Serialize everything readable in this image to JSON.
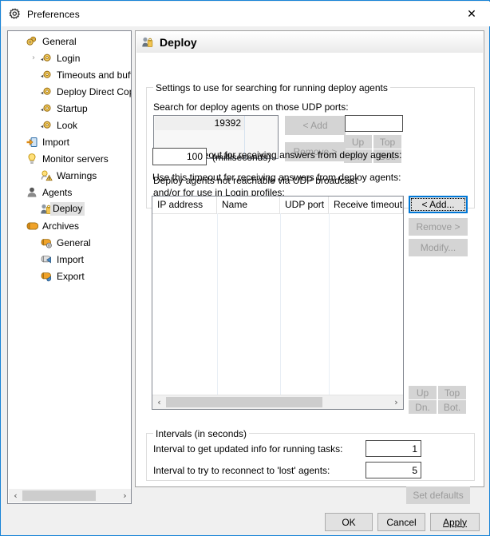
{
  "window": {
    "title": "Preferences",
    "title_icon": "gear-icon",
    "close_label": "✕"
  },
  "sidebar": {
    "items": [
      {
        "label": "General",
        "indent": 0,
        "icon": "gears-icon",
        "expander": "",
        "selected": false
      },
      {
        "label": "Login",
        "indent": 1,
        "icon": "gear-small-icon",
        "expander": "›",
        "selected": false
      },
      {
        "label": "Timeouts and buffer",
        "indent": 1,
        "icon": "gear-small-icon",
        "expander": "",
        "selected": false
      },
      {
        "label": "Deploy Direct Copy",
        "indent": 1,
        "icon": "gear-small-icon",
        "expander": "",
        "selected": false
      },
      {
        "label": "Startup",
        "indent": 1,
        "icon": "gear-small-icon",
        "expander": "",
        "selected": false
      },
      {
        "label": "Look",
        "indent": 1,
        "icon": "gear-small-icon",
        "expander": "",
        "selected": false
      },
      {
        "label": "Import",
        "indent": 0,
        "icon": "import-icon",
        "expander": "",
        "selected": false
      },
      {
        "label": "Monitor servers",
        "indent": 0,
        "icon": "bulb-icon",
        "expander": "",
        "selected": false
      },
      {
        "label": "Warnings",
        "indent": 1,
        "icon": "warning-icon",
        "expander": "",
        "selected": false
      },
      {
        "label": "Agents",
        "indent": 0,
        "icon": "person-icon",
        "expander": "",
        "selected": false
      },
      {
        "label": "Deploy",
        "indent": 1,
        "icon": "deploy-icon",
        "expander": "",
        "selected": true
      },
      {
        "label": "Archives",
        "indent": 0,
        "icon": "archive-icon",
        "expander": "",
        "selected": false
      },
      {
        "label": "General",
        "indent": 1,
        "icon": "archive-gear-icon",
        "expander": "",
        "selected": false
      },
      {
        "label": "Import",
        "indent": 1,
        "icon": "archive-in-icon",
        "expander": "",
        "selected": false
      },
      {
        "label": "Export",
        "indent": 1,
        "icon": "archive-out-icon",
        "expander": "",
        "selected": false
      }
    ],
    "scroll_left_arrow": "‹",
    "scroll_right_arrow": "›"
  },
  "page": {
    "icon": "deploy-icon",
    "title": "Deploy"
  },
  "search_group": {
    "legend": "Settings to use for searching for running deploy agents",
    "ports_label": "Search for deploy agents on those UDP ports:",
    "ports": [
      "19392"
    ],
    "add_button": "<     Add",
    "remove_button": "Remove >",
    "new_port_value": "",
    "move_buttons": [
      "Up",
      "Top",
      "Dn.",
      "Bot."
    ],
    "timeout_label": "Use this timeout for receiving answers from deploy agents:",
    "timeout_value": "100",
    "timeout_units": "(milliseconds)"
  },
  "agents_section": {
    "label_line1": "Deploy agents not reachable via UDP broadcast",
    "label_line2": "and/or for use in Login profiles:",
    "columns": [
      "IP address",
      "Name",
      "UDP port",
      "Receive timeout (in"
    ],
    "rows": [],
    "add_button": "<     Add...",
    "remove_button": "Remove >",
    "modify_button": "Modify...",
    "move_buttons": [
      "Up",
      "Top",
      "Dn.",
      "Bot."
    ],
    "scroll_left_arrow": "‹",
    "scroll_right_arrow": "›"
  },
  "intervals_group": {
    "legend": "Intervals (in seconds)",
    "row1_label": "Interval to get updated info for running tasks:",
    "row1_value": "1",
    "row2_label": "Interval to try to reconnect to 'lost' agents:",
    "row2_value": "5"
  },
  "set_defaults_button": "Set defaults",
  "dialog_buttons": {
    "ok": "OK",
    "cancel": "Cancel",
    "apply": "Apply"
  },
  "colors": {
    "window_border": "#1883d7",
    "focus_blue": "#0078d7",
    "panel_bg": "#f0f0f0",
    "disabled_text": "#9a9a9a"
  }
}
